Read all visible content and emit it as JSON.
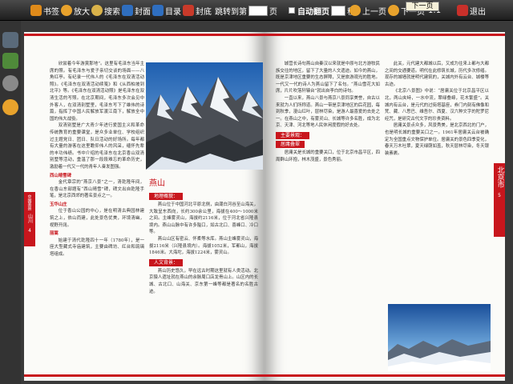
{
  "toolbar": {
    "bookmark": "书签",
    "zoom": "放大",
    "search": "搜索",
    "cover": "封面",
    "toc": "目录",
    "back_cover": "封底",
    "jump_to": "跳转到第",
    "page_unit": "页",
    "autoflip": "自动翻页",
    "seconds": "秒",
    "prev": "上一页",
    "next": "下一页",
    "ratio": "1:1",
    "exit": "退出"
  },
  "tooltip": "下一页",
  "left_page": {
    "tab_series": "中国美景",
    "tab_title": "山川",
    "tab_sub": "北京",
    "page_number": "4",
    "col1": [
      "欣尝着今年游賞那地”。这里有毛泽东当年主席的照。有毛泽东与爱子亲切交谈的场面——八角红亭。有纪录一代伟人的《毛泽东在双清活动照》。《毛泽东在双清活动续笺》和《从西柏坡到北平》等。《毛泽东在双清活动照》是毛泽东在双清生活的写照。在北京期间，毛泽东多次会见中外客人，在双清别墅里，毛泽东写下了雄伟的诗篇，指挥了中国人民解放军渡江南下，解放全中国的伟大战役。",
      "双清别墅是广大青少年进行爱国主义和革命传统教育的重要课堂，是众多业单位、学校组织过主题党日、团日、队日活动的好场所。每年都有大量的游客在这里瞻仰伟人的风采，缅怀先辈的丰功伟绩。书中介绍的毛泽东在北京香山双清别墅等活动，重温了那一段段难忘的革命历史，激励着一代又一代的青年人奋发图强。"
    ],
    "sub1": "西山晴雪碑",
    "col1b": "金代章宗的“燕京八景”之一，清乾隆年间，在香山东部题有“西山晴雪”碑，碑文出自乾隆手笔，是北京西郊的著名景点之一。",
    "sub2": "玉华山庄",
    "col1c": "位于香山公园的中心，是在明清古典园林建筑之上，依山而建，此处景色优美，环境清幽，视野开阔。",
    "sub3": "丽嵩",
    "col1d": "始建于清代乾隆四十一年（1780年），是一座大型藏式寺庙建筑，主要由碑坊、红台和琉璃塔组成。",
    "section_title": "燕山",
    "redhead1": "地理概貌：",
    "col2a": "燕山位于中国河北平原北侧，由潮白河谷至山海关，大致呈东西向，长约300余公里，海拔在400～1000米之间。主峰雾灵山，海拔约2116米，位于河北省兴隆县境内。燕山山脉中有许多隘口，如古北口、喜峰口、冷口等。",
    "col2b": "燕山山区有密云、怀柔等水库。燕山主峰雾灵山，海拔2116米（兴隆县境内）。海拔1052米，军都山，海拔1846米。大海坨，海拔1224米，雾灵山。",
    "redhead2": "人文背景：",
    "col2c": "燕山历史悠久，早在远古时期这里就有人类活动。北京猿人遗址就在燕山的余脉周口店龙骨山上。山区内的长城、古北口、山海关、京东第一峰等都是著名的名胜古迹。"
  },
  "right_page": {
    "tab_title": "北京市",
    "page_number": "5",
    "col3a": "城营长诗句燕山自秦汉以来就是中原与北方游牧民族交往的地区，留下了大量的人文遗迹。如今的燕山，既是京津地区重要的生态屏障，又是旅游观光的胜地。一代又一代的诗人为燕山留下了名句。“燕山雪花大如席，片片吹落轩辕台”就出自李白的诗句。",
    "col3b": "一直以来，燕山八景与燕京八景同享美誉，自古以来就为人们所称道。燕山一带是京津地区的后花园，每到秋季，漫山红叶，层林尽染，是游人最喜爱的去处之一。在燕山之中，有雾灵山、长城等许多名胜，成为北京、天津、河北等地人民休闲度假的好去处。",
    "redhead3": "主要景观：",
    "sub4": "居庸叠翠",
    "col3c": "居庸关是长城的重要关口，位于北京市昌平区，四周群山环抱，林木茂盛，景色秀丽。",
    "col4a": "此关，元代建大都城以后，又成为往来上都与大都之间的交通要道。明代在此修筑长城，历代多次修缮。现存的城墙就是明代建筑的，关城内外有云台、城楼等古迹。",
    "col4b": "《北京八景图》中说：“居庸关位于北京昌平区以北，两山夹峙，一水中流，翠绿叠嶂，花木繁盛”。关城内有云台，是元代的过街塔基座，券门内刻有佛像和梵、藏、八思巴、维吾尔、西夏、汉六种文字的陀罗尼经咒，是研究古代文字的珍贵资料。",
    "col4c": "居庸关景点众多，风景秀美，是北京西北的门户，也是明长城的重要关口之一。1961年居庸关云台被确定为全国重点文物保护单位。居庸关的景色四季变化，春天万木吐翠，夏天绿荫如盖，秋天层林尽染，冬天银装素裹。"
  }
}
